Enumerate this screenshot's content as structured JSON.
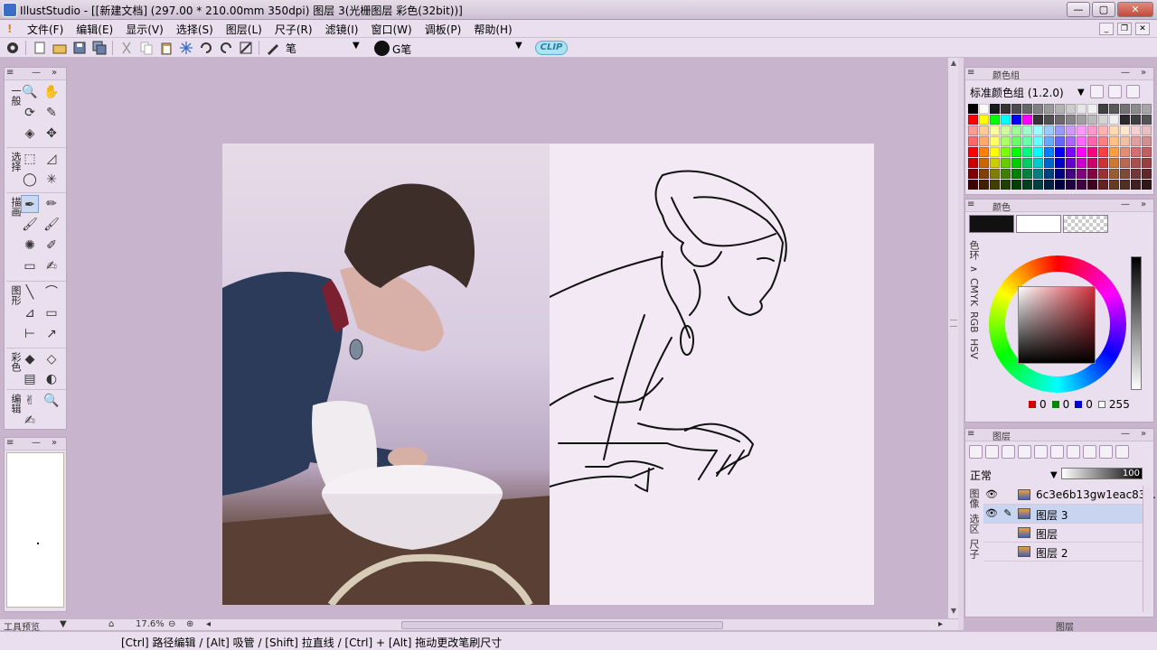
{
  "title": "IllustStudio - [[新建文档] (297.00 * 210.00mm 350dpi)   图层 3(光栅图层 彩色(32bit))]",
  "menu": [
    "文件(F)",
    "编辑(E)",
    "显示(V)",
    "选择(S)",
    "图层(L)",
    "尺子(R)",
    "滤镜(I)",
    "窗口(W)",
    "调板(P)",
    "帮助(H)"
  ],
  "toolbar": {
    "brush_label": "笔",
    "color_label": "G笔",
    "logo": "CLIP"
  },
  "toolbox": {
    "groups": [
      "一般",
      "选择",
      "描画",
      "图形",
      "彩色",
      "编辑"
    ]
  },
  "preview_panel": {
    "title": "工具预览"
  },
  "hscroll": {
    "zoom": "17.6%"
  },
  "status": "[Ctrl] 路径编辑 / [Alt] 吸管 / [Shift] 拉直线 / [Ctrl] + [Alt] 拖动更改笔刷尺寸",
  "color_set": {
    "title": "颜色组",
    "name": "标准颜色组 (1.2.0)"
  },
  "color_panel": {
    "title": "颜色",
    "tabs": [
      "色环",
      "∧",
      "CMYK",
      "RGB",
      "HSV"
    ],
    "r": "0",
    "g": "0",
    "b": "0",
    "alpha": "255",
    "main_color": "#111111",
    "sub_color": "#ffffff"
  },
  "layer_panel": {
    "title": "图层",
    "blend_mode": "正常",
    "opacity": "100",
    "tabs": [
      "图像",
      "选区",
      "尺子"
    ],
    "layers": [
      {
        "name": "6c3e6b13gw1eac83...",
        "visible": true,
        "selected": false,
        "editing": false
      },
      {
        "name": "图层 3",
        "visible": true,
        "selected": true,
        "editing": true
      },
      {
        "name": "图层",
        "visible": false,
        "selected": false,
        "editing": false
      },
      {
        "name": "图层 2",
        "visible": false,
        "selected": false,
        "editing": false
      }
    ],
    "footer": "图层"
  },
  "swatch_colors": [
    "#000000",
    "#ffffff",
    "#1a1a1a",
    "#333333",
    "#4d4d4d",
    "#666666",
    "#808080",
    "#999999",
    "#b3b3b3",
    "#cccccc",
    "#e6e6e6",
    "#f0f0f0",
    "#404040",
    "#595959",
    "#737373",
    "#8c8c8c",
    "#a6a6a6",
    "#ff0000",
    "#ffff00",
    "#00ff00",
    "#00ffff",
    "#0000ff",
    "#ff00ff",
    "#333333",
    "#505050",
    "#6a6a6a",
    "#858585",
    "#9f9f9f",
    "#bababa",
    "#d4d4d4",
    "#efefef",
    "#2a2a2a",
    "#3f3f3f",
    "#545454",
    "#ff9999",
    "#ffcc99",
    "#ffff99",
    "#ccff99",
    "#99ff99",
    "#99ffcc",
    "#99ffff",
    "#99ccff",
    "#9999ff",
    "#cc99ff",
    "#ff99ff",
    "#ff99cc",
    "#ffb3b3",
    "#ffd9b3",
    "#ffe6cc",
    "#f5d0d0",
    "#e8c0c0",
    "#ff6666",
    "#ffaa66",
    "#ffff66",
    "#aaff66",
    "#66ff66",
    "#66ffaa",
    "#66ffff",
    "#66aaff",
    "#6666ff",
    "#aa66ff",
    "#ff66ff",
    "#ff66aa",
    "#ff8080",
    "#ffbf80",
    "#f0c0a0",
    "#e0a0a0",
    "#d09090",
    "#ff0000",
    "#ff8000",
    "#ffff00",
    "#80ff00",
    "#00ff00",
    "#00ff80",
    "#00ffff",
    "#0080ff",
    "#0000ff",
    "#8000ff",
    "#ff00ff",
    "#ff0080",
    "#ff4040",
    "#ff9f40",
    "#e09070",
    "#d07070",
    "#c06060",
    "#cc0000",
    "#cc6600",
    "#cccc00",
    "#66cc00",
    "#00cc00",
    "#00cc66",
    "#00cccc",
    "#0066cc",
    "#0000cc",
    "#6600cc",
    "#cc00cc",
    "#cc0066",
    "#cc3333",
    "#cc7a33",
    "#b86a50",
    "#a85050",
    "#984040",
    "#800000",
    "#804000",
    "#808000",
    "#408000",
    "#008000",
    "#008040",
    "#008080",
    "#004080",
    "#000080",
    "#400080",
    "#800080",
    "#800040",
    "#993333",
    "#995c33",
    "#804a38",
    "#703838",
    "#602828",
    "#400000",
    "#402000",
    "#404000",
    "#204000",
    "#004000",
    "#004020",
    "#004040",
    "#002040",
    "#000040",
    "#200040",
    "#400040",
    "#400020",
    "#662222",
    "#663d22",
    "#503020",
    "#402020",
    "#301818"
  ]
}
